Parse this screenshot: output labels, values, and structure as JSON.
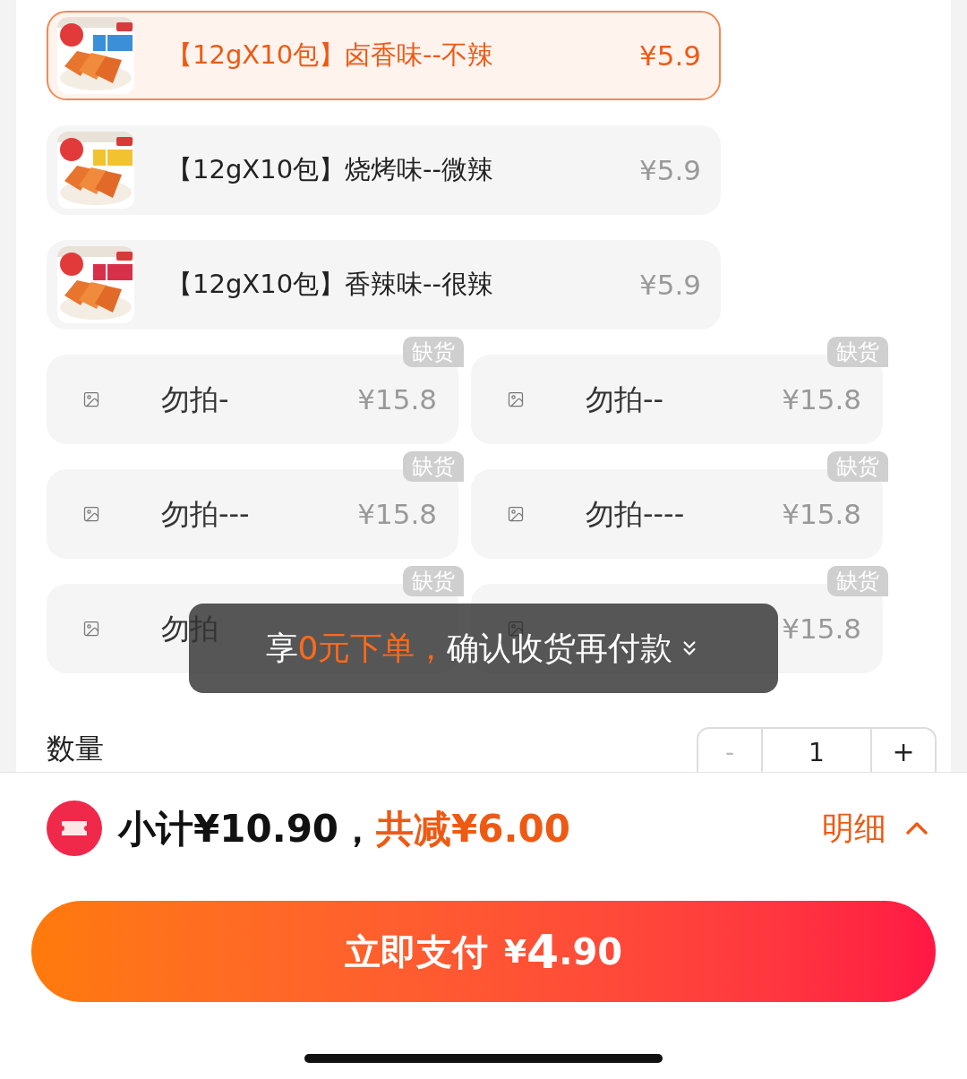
{
  "variants": [
    {
      "name": "【12gX10包】卤香味--不辣",
      "price": "¥5.9",
      "selected": true
    },
    {
      "name": "【12gX10包】烧烤味--微辣",
      "price": "¥5.9",
      "selected": false
    },
    {
      "name": "【12gX10包】香辣味--很辣",
      "price": "¥5.9",
      "selected": false
    }
  ],
  "unavailable": [
    {
      "name": "勿拍-",
      "price": "¥15.8",
      "badge": "缺货"
    },
    {
      "name": "勿拍--",
      "price": "¥15.8",
      "badge": "缺货"
    },
    {
      "name": "勿拍---",
      "price": "¥15.8",
      "badge": "缺货"
    },
    {
      "name": "勿拍----",
      "price": "¥15.8",
      "badge": "缺货"
    },
    {
      "name": "勿拍",
      "badge": "缺货"
    },
    {
      "price": "¥15.8",
      "badge": "缺货"
    }
  ],
  "toast": {
    "prefix": "享",
    "highlight": "0元下单，",
    "rest": "确认收货再付款"
  },
  "quantity": {
    "label": "数量",
    "minus": "-",
    "value": "1",
    "plus": "+"
  },
  "summary": {
    "subtotal": "小计¥10.90，",
    "discount": "共减¥6.00",
    "details": "明细"
  },
  "pay_button": {
    "label": "立即支付",
    "currency": "¥",
    "amount_main": "4",
    "amount_decimal": ".90"
  }
}
